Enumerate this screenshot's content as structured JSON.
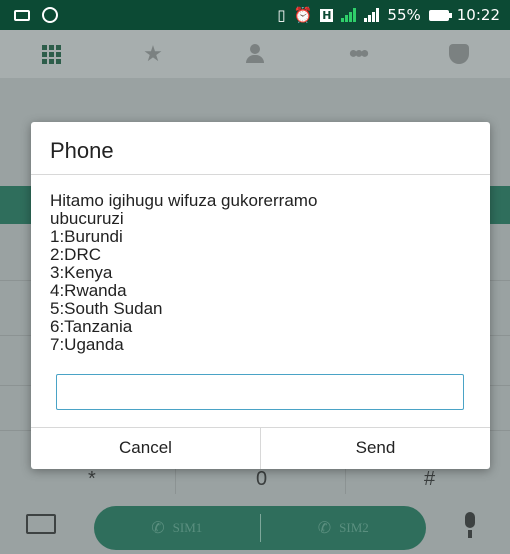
{
  "status_bar": {
    "battery_percent": "55%",
    "time": "10:22",
    "icons": [
      "message-icon",
      "call-icon",
      "vibrate-icon",
      "alarm-icon",
      "h-data-icon",
      "signal-sim1-icon",
      "signal-sim2-icon",
      "battery-icon"
    ]
  },
  "dialer_tabs": [
    "keypad-icon",
    "favorites-icon",
    "contacts-icon",
    "groups-icon",
    "blocked-icon"
  ],
  "keypad": {
    "keys": [
      "*",
      "0",
      "#"
    ],
    "sim1_label": "SIM1",
    "sim2_label": "SIM2"
  },
  "dialog": {
    "title": "Phone",
    "message": "Hitamo igihugu wifuza gukorerramo\nubucuruzi\n1:Burundi\n2:DRC\n3:Kenya\n4:Rwanda\n5:South Sudan\n6:Tanzania\n7:Uganda",
    "input_value": "",
    "cancel_label": "Cancel",
    "send_label": "Send"
  },
  "colors": {
    "status_bar": "#0c4a34",
    "accent": "#2f6e5c",
    "input_border": "#4aa3c6"
  }
}
